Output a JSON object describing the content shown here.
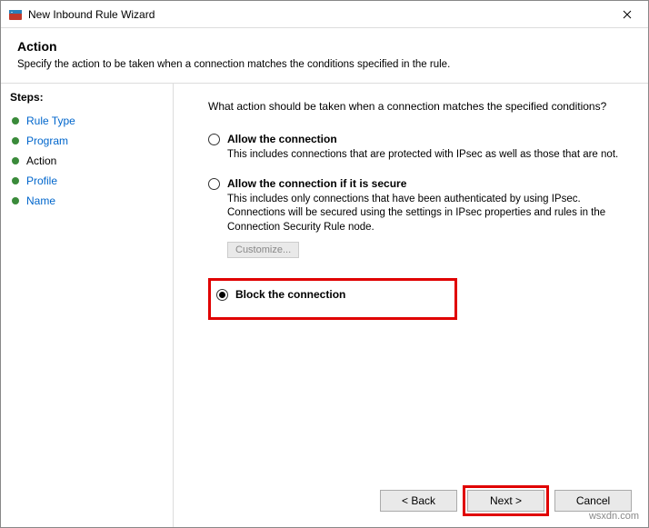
{
  "window": {
    "title": "New Inbound Rule Wizard"
  },
  "header": {
    "heading": "Action",
    "subtitle": "Specify the action to be taken when a connection matches the conditions specified in the rule."
  },
  "steps": {
    "label": "Steps:",
    "items": [
      {
        "label": "Rule Type",
        "state": "link"
      },
      {
        "label": "Program",
        "state": "link"
      },
      {
        "label": "Action",
        "state": "current"
      },
      {
        "label": "Profile",
        "state": "link"
      },
      {
        "label": "Name",
        "state": "link"
      }
    ]
  },
  "content": {
    "question": "What action should be taken when a connection matches the specified conditions?",
    "options": [
      {
        "id": "allow",
        "title": "Allow the connection",
        "desc": "This includes connections that are protected with IPsec as well as those that are not.",
        "selected": false
      },
      {
        "id": "allow-secure",
        "title": "Allow the connection if it is secure",
        "desc": "This includes only connections that have been authenticated by using IPsec. Connections will be secured using the settings in IPsec properties and rules in the Connection Security Rule node.",
        "selected": false,
        "customize_label": "Customize..."
      },
      {
        "id": "block",
        "title": "Block the connection",
        "selected": true
      }
    ]
  },
  "footer": {
    "back": "< Back",
    "next": "Next >",
    "cancel": "Cancel"
  },
  "watermark": "wsxdn.com"
}
